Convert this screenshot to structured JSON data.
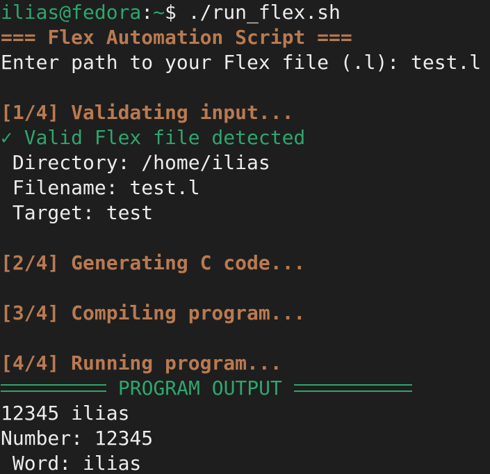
{
  "prompt": {
    "user_host": "ilias@fedora",
    "separator": ":",
    "path": "~",
    "symbol": "$",
    "command": " ./run_flex.sh"
  },
  "header": "=== Flex Automation Script ===",
  "input_line": "Enter path to your Flex file (.l): test.l",
  "step1": {
    "title": "[1/4] Validating input...",
    "valid": "✓ Valid Flex file detected",
    "directory": " Directory: /home/ilias",
    "filename": " Filename: test.l",
    "target": " Target: test"
  },
  "step2": {
    "title": "[2/4] Generating C code..."
  },
  "step3": {
    "title": "[3/4] Compiling program..."
  },
  "step4": {
    "title": "[4/4] Running program..."
  },
  "output_banner": "PROGRAM OUTPUT",
  "output_lines": [
    "12345 ilias",
    "Number: 12345",
    " Word: ilias"
  ],
  "colors": {
    "background": "#1e1e1e",
    "text": "#ececec",
    "green": "#2ea66e",
    "orange": "#b97a51"
  }
}
